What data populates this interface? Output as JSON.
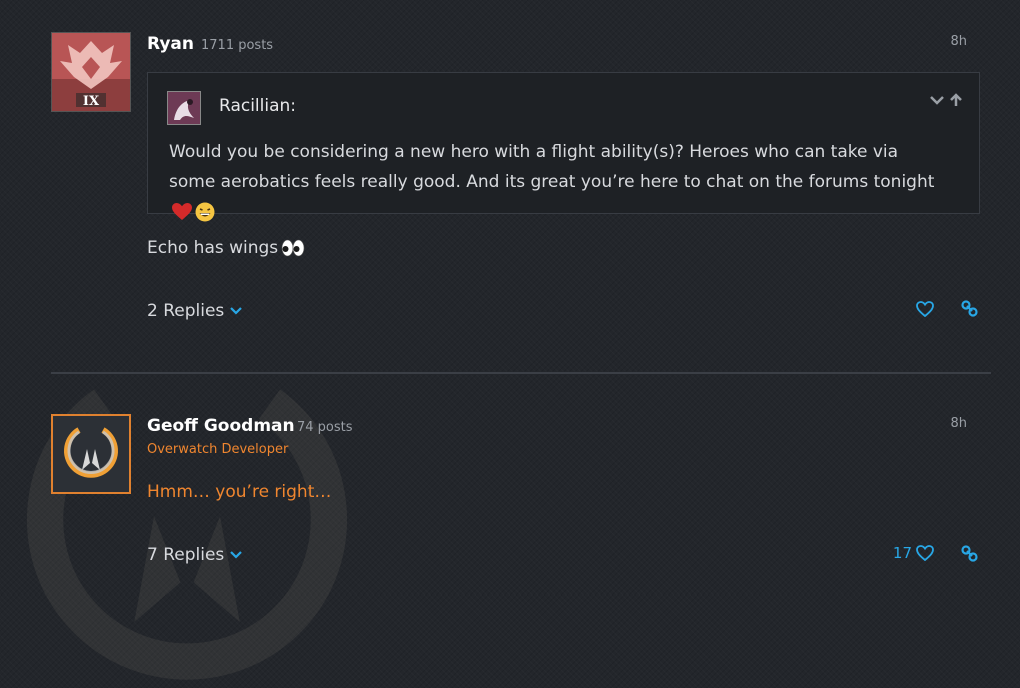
{
  "posts": [
    {
      "author": "Ryan",
      "post_count": "1711 posts",
      "time": "8h",
      "badge_rank": "IX",
      "quote": {
        "author": "Racillian:",
        "text": "Would you be considering a new hero with a flight ability(s)? Heroes who can take via some aerobatics feels really good. And its great you’re here to chat on the forums tonight"
      },
      "body": "Echo has wings",
      "replies_label": "2 Replies",
      "like_count": ""
    },
    {
      "author": "Geoff Goodman",
      "post_count": "74 posts",
      "role": "Overwatch Developer",
      "time": "8h",
      "body": "Hmm… you’re right…",
      "replies_label": "7 Replies",
      "like_count": "17"
    }
  ],
  "colors": {
    "background": "#23262b",
    "accent_blue": "#28a7e6",
    "developer_orange": "#f0862f",
    "quote_background": "#1e2125"
  },
  "icons": [
    "collapse-chevron-icon",
    "jump-up-arrow-icon",
    "heart-emoji",
    "grinning-emoji",
    "eyes-emoji",
    "chevron-down-icon",
    "like-heart-icon",
    "share-link-icon",
    "overwatch-logo-icon",
    "rank-badge-icon"
  ]
}
